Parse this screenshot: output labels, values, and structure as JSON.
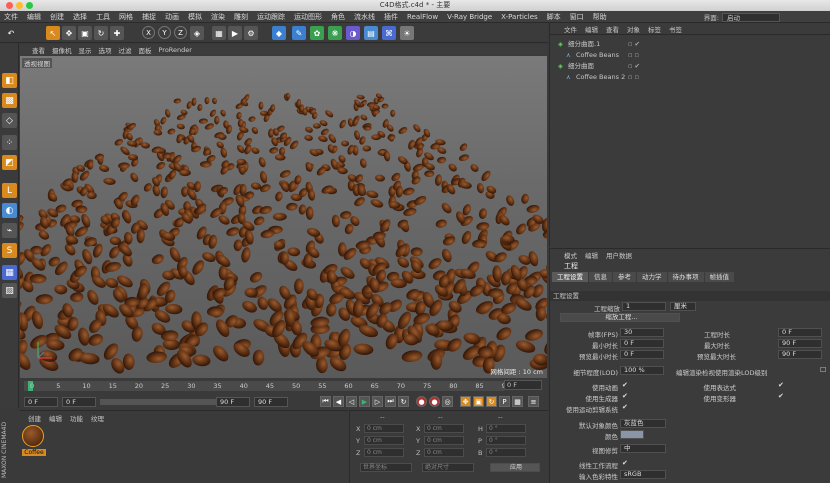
{
  "window": {
    "title": "C4D格式.c4d * - 主要"
  },
  "menubar": [
    "文件",
    "编辑",
    "创建",
    "选择",
    "工具",
    "网格",
    "捕捉",
    "动画",
    "模拟",
    "渲染",
    "雕刻",
    "运动跟踪",
    "运动图形",
    "角色",
    "流水线",
    "插件",
    "RealFlow",
    "V-Ray Bridge",
    "X-Particles",
    "脚本",
    "窗口",
    "帮助"
  ],
  "layout": {
    "label": "界面:",
    "value": "启动"
  },
  "toolbar": {
    "axis_x": "X",
    "axis_y": "Y",
    "axis_z": "Z"
  },
  "viewport": {
    "menu": [
      "查看",
      "摄像机",
      "显示",
      "选项",
      "过滤",
      "面板",
      "ProRender"
    ],
    "label": "透视视图",
    "grid_info": "网格间距 : 10 cm"
  },
  "timeline": {
    "ticks": [
      "0",
      "5",
      "10",
      "15",
      "20",
      "25",
      "30",
      "35",
      "40",
      "45",
      "50",
      "55",
      "60",
      "65",
      "70",
      "75",
      "80",
      "85",
      "90"
    ],
    "frame": "0 F"
  },
  "transport": {
    "start": "0 F",
    "current": "0 F",
    "end": "90 F",
    "end2": "90 F"
  },
  "materials": {
    "menu": [
      "创建",
      "编辑",
      "功能",
      "纹理"
    ],
    "item": "Coffee"
  },
  "coordinates": {
    "header": "--",
    "rows": [
      {
        "a": "X",
        "av": "0 cm",
        "b": "X",
        "bv": "0 cm",
        "c": "H",
        "cv": "0 °"
      },
      {
        "a": "Y",
        "av": "0 cm",
        "b": "Y",
        "bv": "0 cm",
        "c": "P",
        "cv": "0 °"
      },
      {
        "a": "Z",
        "av": "0 cm",
        "b": "Z",
        "bv": "0 cm",
        "c": "B",
        "cv": "0 °"
      }
    ],
    "mode1": "世界坐标",
    "mode2": "绝对尺寸",
    "apply": "应用"
  },
  "objects": {
    "menu": [
      "文件",
      "编辑",
      "查看",
      "对象",
      "标签",
      "书签"
    ],
    "items": [
      {
        "name": "细分曲面.1",
        "indent": 0
      },
      {
        "name": "Coffee Beans",
        "indent": 1
      },
      {
        "name": "细分曲面",
        "indent": 0
      },
      {
        "name": "Coffee Beans 2",
        "indent": 1
      }
    ]
  },
  "attributes": {
    "menu": [
      "模式",
      "编辑",
      "用户数据"
    ],
    "title": "工程",
    "tabs": [
      "工程设置",
      "信息",
      "参考",
      "动力学",
      "待办事项",
      "帧插值"
    ],
    "section": "工程设置",
    "scale_label": "工程缩放",
    "scale_value": "1",
    "scale_unit": "厘米",
    "scale_button": "缩放工程...",
    "fps_label": "帧率(FPS)",
    "fps": "30",
    "duration_label": "工程时长",
    "duration": "0 F",
    "min_time_label": "最小时长",
    "min_time": "0 F",
    "max_time_label": "最大时长",
    "max_time": "90 F",
    "prev_min_label": "预览最小时长",
    "prev_min": "0 F",
    "prev_max_label": "预览最大时长",
    "prev_max": "90 F",
    "lod_label": "细节程度(LOD)",
    "lod": "100 %",
    "lod_render_label": "编辑渲染检视使用渲染LOD级别",
    "use_anim": "使用动画",
    "use_expr": "使用表达式",
    "use_gen": "使用生成器",
    "use_deform": "使用变形器",
    "use_motion": "使用运动剪辑系统",
    "default_color_label": "默认对象颜色",
    "default_color_value": "灰蓝色",
    "color_label": "颜色",
    "view_clip_label": "视图修剪",
    "view_clip_value": "中",
    "linear_label": "线性工作流程",
    "input_color_label": "输入色彩特性",
    "input_color_value": "sRGB"
  }
}
